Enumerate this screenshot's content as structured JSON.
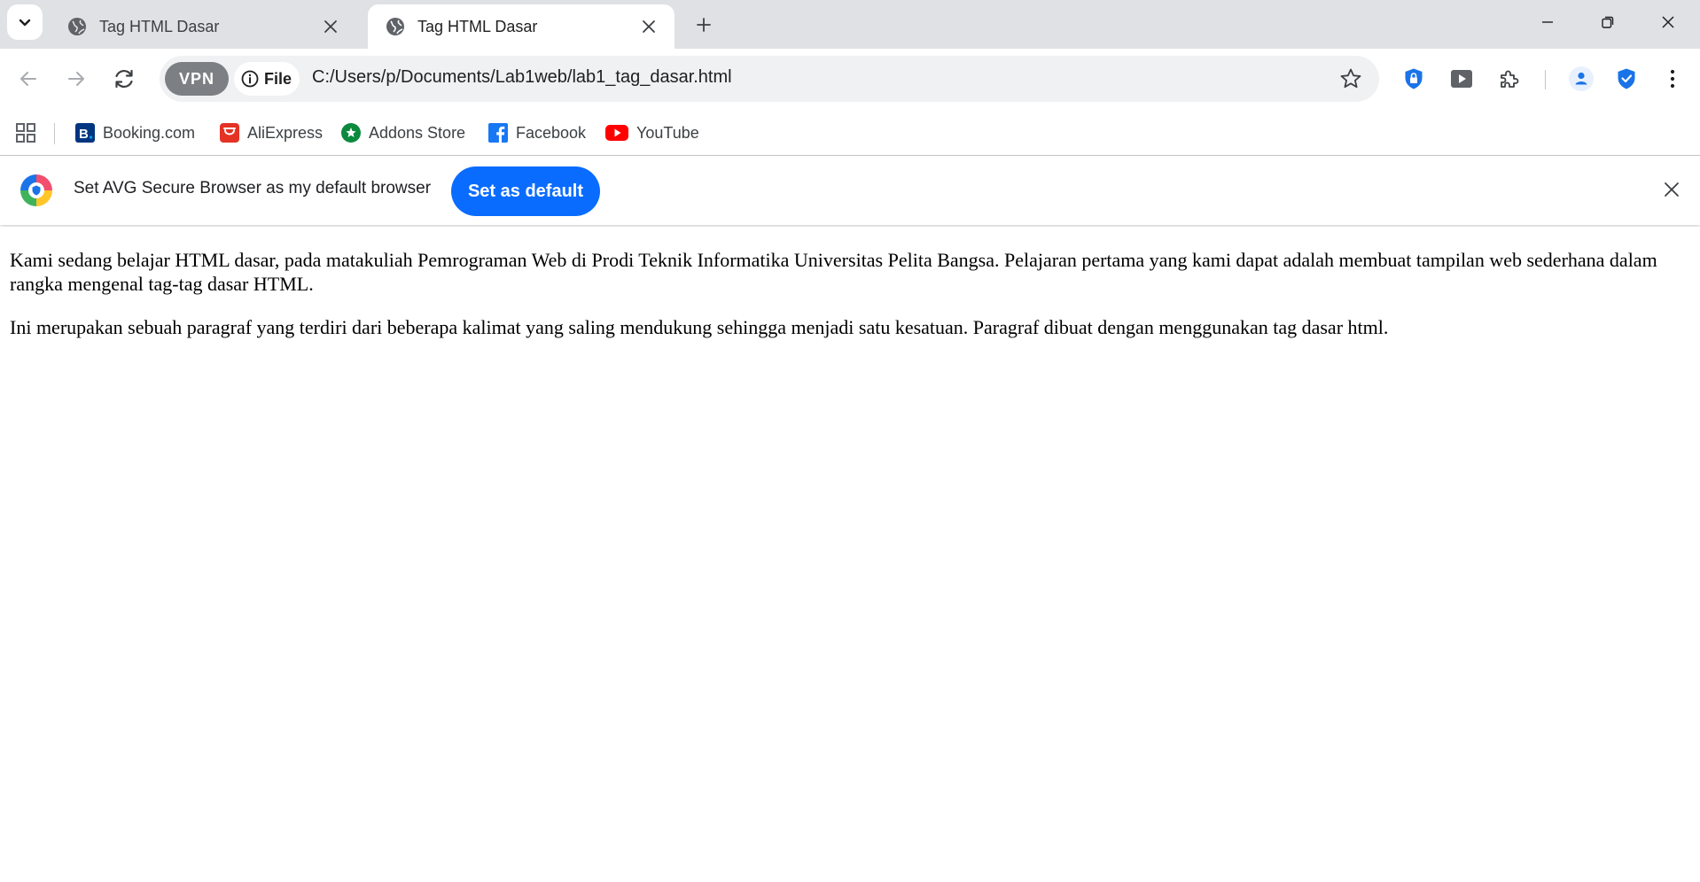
{
  "browser": {
    "tabs": [
      {
        "title": "Tag HTML Dasar",
        "active": false
      },
      {
        "title": "Tag HTML Dasar",
        "active": true
      }
    ],
    "address_bar": {
      "vpn_label": "VPN",
      "site_chip_label": "File",
      "url": "C:/Users/p/Documents/Lab1web/lab1_tag_dasar.html"
    },
    "bookmarks": [
      {
        "label": "Booking.com",
        "icon": "booking-icon"
      },
      {
        "label": "AliExpress",
        "icon": "aliexpress-icon"
      },
      {
        "label": "Addons Store",
        "icon": "addons-store-icon"
      },
      {
        "label": "Facebook",
        "icon": "facebook-icon"
      },
      {
        "label": "YouTube",
        "icon": "youtube-icon"
      }
    ],
    "infobar": {
      "message": "Set AVG Secure Browser as my default browser",
      "button_label": "Set as default"
    }
  },
  "page": {
    "paragraphs": [
      "Kami sedang belajar HTML dasar, pada matakuliah Pemrograman Web di Prodi Teknik Informatika Universitas Pelita Bangsa. Pelajaran pertama yang kami dapat adalah membuat tampilan web sederhana dalam rangka mengenal tag-tag dasar HTML.",
      "Ini merupakan sebuah paragraf yang terdiri dari beberapa kalimat yang saling mendukung sehingga menjadi satu kesatuan. Paragraf dibuat dengan menggunakan tag dasar html."
    ]
  },
  "colors": {
    "tabstrip_bg": "#dfe1e5",
    "omnibox_bg": "#eff1f3",
    "accent_button": "#0a6cff",
    "avg_shield_blue": "#1a73e8",
    "booking_blue": "#003580",
    "aliexpress_red": "#e43225",
    "addons_green": "#0b8a3e",
    "facebook_blue": "#1877f2",
    "youtube_red": "#ff0000"
  }
}
